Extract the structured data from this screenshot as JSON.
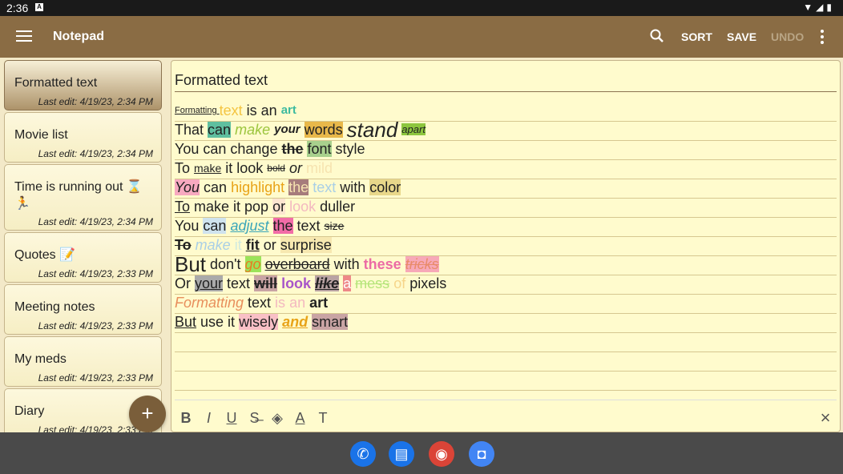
{
  "status": {
    "time": "2:36",
    "sim_badge": "A",
    "icons": "▼◢▮"
  },
  "appbar": {
    "title": "Notepad",
    "actions": {
      "sort": "SORT",
      "save": "SAVE",
      "undo": "UNDO"
    }
  },
  "notes": [
    {
      "title": "Formatted text",
      "edit": "Last edit: 4/19/23, 2:34 PM",
      "active": true
    },
    {
      "title": "Movie list",
      "edit": "Last edit: 4/19/23, 2:34 PM"
    },
    {
      "title": "Time is running out ⌛🏃",
      "edit": "Last edit: 4/19/23, 2:34 PM"
    },
    {
      "title": "Quotes 📝",
      "edit": "Last edit: 4/19/23, 2:33 PM"
    },
    {
      "title": "Meeting notes",
      "edit": "Last edit: 4/19/23, 2:33 PM"
    },
    {
      "title": "My meds",
      "edit": "Last edit: 4/19/23, 2:33 PM"
    },
    {
      "title": "Diary",
      "edit": "Last edit: 4/19/23, 2:33 PM"
    }
  ],
  "fab": {
    "label": "+"
  },
  "editor": {
    "title": "Formatted text",
    "lines": [
      [
        {
          "t": "Formatting ",
          "s": "font-size:11px;text-decoration:underline"
        },
        {
          "t": "text",
          "s": "color:#f4c542;font-size:18px"
        },
        {
          "t": " is an "
        },
        {
          "t": "art",
          "s": "color:#3cba9f;font-weight:bold;font-size:15px"
        }
      ],
      [
        {
          "t": "That "
        },
        {
          "t": "can",
          "s": "background:#5fbf9f"
        },
        {
          "t": " "
        },
        {
          "t": "make",
          "s": "color:#9bc53d;font-style:italic"
        },
        {
          "t": " "
        },
        {
          "t": "your",
          "s": "font-weight:bold;font-style:italic;font-size:15px"
        },
        {
          "t": " "
        },
        {
          "t": "words",
          "s": "background:#e8b84a"
        },
        {
          "t": " "
        },
        {
          "t": "stand",
          "s": "font-size:26px;font-style:italic"
        },
        {
          "t": " "
        },
        {
          "t": "apart",
          "s": "background:#8dc63f;font-style:italic;font-size:13px"
        }
      ],
      [
        {
          "t": "You can change "
        },
        {
          "t": "the",
          "s": "font-weight:bold;text-decoration:line-through"
        },
        {
          "t": " "
        },
        {
          "t": "font",
          "s": "background:#a8d08d"
        },
        {
          "t": " style"
        }
      ],
      [
        {
          "t": "To "
        },
        {
          "t": "make",
          "s": "font-size:14px;text-decoration:underline"
        },
        {
          "t": " it look "
        },
        {
          "t": "bold",
          "s": "font-size:12px;text-decoration:line-through"
        },
        {
          "t": " "
        },
        {
          "t": "or",
          "s": "font-style:italic"
        },
        {
          "t": " "
        },
        {
          "t": "mild",
          "s": "color:#f6e3b0"
        }
      ],
      [
        {
          "t": "You",
          "s": "background:#f7a9c0;font-style:italic"
        },
        {
          "t": " can "
        },
        {
          "t": "highlight",
          "s": "color:#e8a317"
        },
        {
          "t": " "
        },
        {
          "t": "the",
          "s": "background:#a67c7c;color:#f6e3b0"
        },
        {
          "t": " "
        },
        {
          "t": "text",
          "s": "color:#a9cfe6"
        },
        {
          "t": " with "
        },
        {
          "t": "color",
          "s": "background:#e8d78a"
        }
      ],
      [
        {
          "t": "To",
          "s": "text-decoration:underline"
        },
        {
          "t": " make it pop "
        },
        {
          "t": "or",
          "s": "background:#fce5d0"
        },
        {
          "t": " "
        },
        {
          "t": "look",
          "s": "color:#f3b8c0"
        },
        {
          "t": " duller"
        }
      ],
      [
        {
          "t": "You "
        },
        {
          "t": "can",
          "s": "background:#cfe3ee"
        },
        {
          "t": " "
        },
        {
          "t": "adjust",
          "s": "color:#3aa6b9;font-style:italic;text-decoration:underline"
        },
        {
          "t": " "
        },
        {
          "t": "the",
          "s": "background:#f26ca7"
        },
        {
          "t": " text "
        },
        {
          "t": "size",
          "s": "font-size:14px;text-decoration:line-through"
        }
      ],
      [
        {
          "t": "To",
          "s": "font-weight:bold;text-decoration:line-through"
        },
        {
          "t": " "
        },
        {
          "t": "make",
          "s": "color:#a9cfe6;font-style:italic"
        },
        {
          "t": " "
        },
        {
          "t": "it",
          "s": "color:#cfe9e0"
        },
        {
          "t": " "
        },
        {
          "t": "fit",
          "s": "font-weight:bold;text-decoration:underline"
        },
        {
          "t": " or "
        },
        {
          "t": "surprise",
          "s": "background:#f7e8b0"
        }
      ],
      [
        {
          "t": "But",
          "s": "font-size:26px"
        },
        {
          "t": " don't "
        },
        {
          "t": "go",
          "s": "background:#9be35a;color:#e67e22;font-style:italic"
        },
        {
          "t": " "
        },
        {
          "t": "overboard",
          "s": "text-decoration:line-through underline"
        },
        {
          "t": " with "
        },
        {
          "t": "these",
          "s": "color:#ec6ba5;font-weight:bold"
        },
        {
          "t": " "
        },
        {
          "t": "tricks",
          "s": "background:#f7a9b8;color:#e98b6a;font-style:italic;text-decoration:line-through"
        }
      ],
      [
        {
          "t": "Or "
        },
        {
          "t": "your",
          "s": "background:#aaa;text-decoration:underline"
        },
        {
          "t": " text "
        },
        {
          "t": "will",
          "s": "background:#c9a4a4;font-weight:bold;text-decoration:line-through"
        },
        {
          "t": " "
        },
        {
          "t": "look",
          "s": "color:#a855c9;font-weight:bold"
        },
        {
          "t": " "
        },
        {
          "t": "like",
          "s": "background:#b9a3a3;font-weight:bold;font-style:italic;text-decoration:line-through underline"
        },
        {
          "t": " "
        },
        {
          "t": "a",
          "s": "background:#e88;color:#fff"
        },
        {
          "t": " "
        },
        {
          "t": "mess",
          "s": "color:#b5e57a;text-decoration:line-through"
        },
        {
          "t": " "
        },
        {
          "t": "of",
          "s": "color:#f6d58a"
        },
        {
          "t": " pixels"
        }
      ],
      [
        {
          "t": "Formatting",
          "s": "color:#e88f5c;font-style:italic"
        },
        {
          "t": " text "
        },
        {
          "t": "is",
          "s": "color:#f3b8c0"
        },
        {
          "t": " "
        },
        {
          "t": "an",
          "s": "color:#f3b8c0"
        },
        {
          "t": " "
        },
        {
          "t": "art",
          "s": "font-weight:bold"
        }
      ],
      [
        {
          "t": "But",
          "s": "text-decoration:underline"
        },
        {
          "t": " use it "
        },
        {
          "t": "wisely",
          "s": "background:#f9c0c6"
        },
        {
          "t": " "
        },
        {
          "t": "and",
          "s": "color:#e8a317;font-weight:bold;font-style:italic;text-decoration:underline"
        },
        {
          "t": " "
        },
        {
          "t": "smart",
          "s": "background:#c9a4a4"
        }
      ],
      [],
      [],
      []
    ],
    "toolbar": [
      "B",
      "I",
      "U",
      "S̶",
      "◈",
      "A",
      "T"
    ],
    "close": "×"
  },
  "navbar": {
    "apps": [
      {
        "name": "phone-app-icon",
        "color": "#1a73e8",
        "glyph": "✆"
      },
      {
        "name": "messages-app-icon",
        "color": "#1a73e8",
        "glyph": "▤"
      },
      {
        "name": "chrome-app-icon",
        "color": "#db4437",
        "glyph": "◉"
      },
      {
        "name": "camera-app-icon",
        "color": "#4285f4",
        "glyph": "◘"
      }
    ]
  }
}
